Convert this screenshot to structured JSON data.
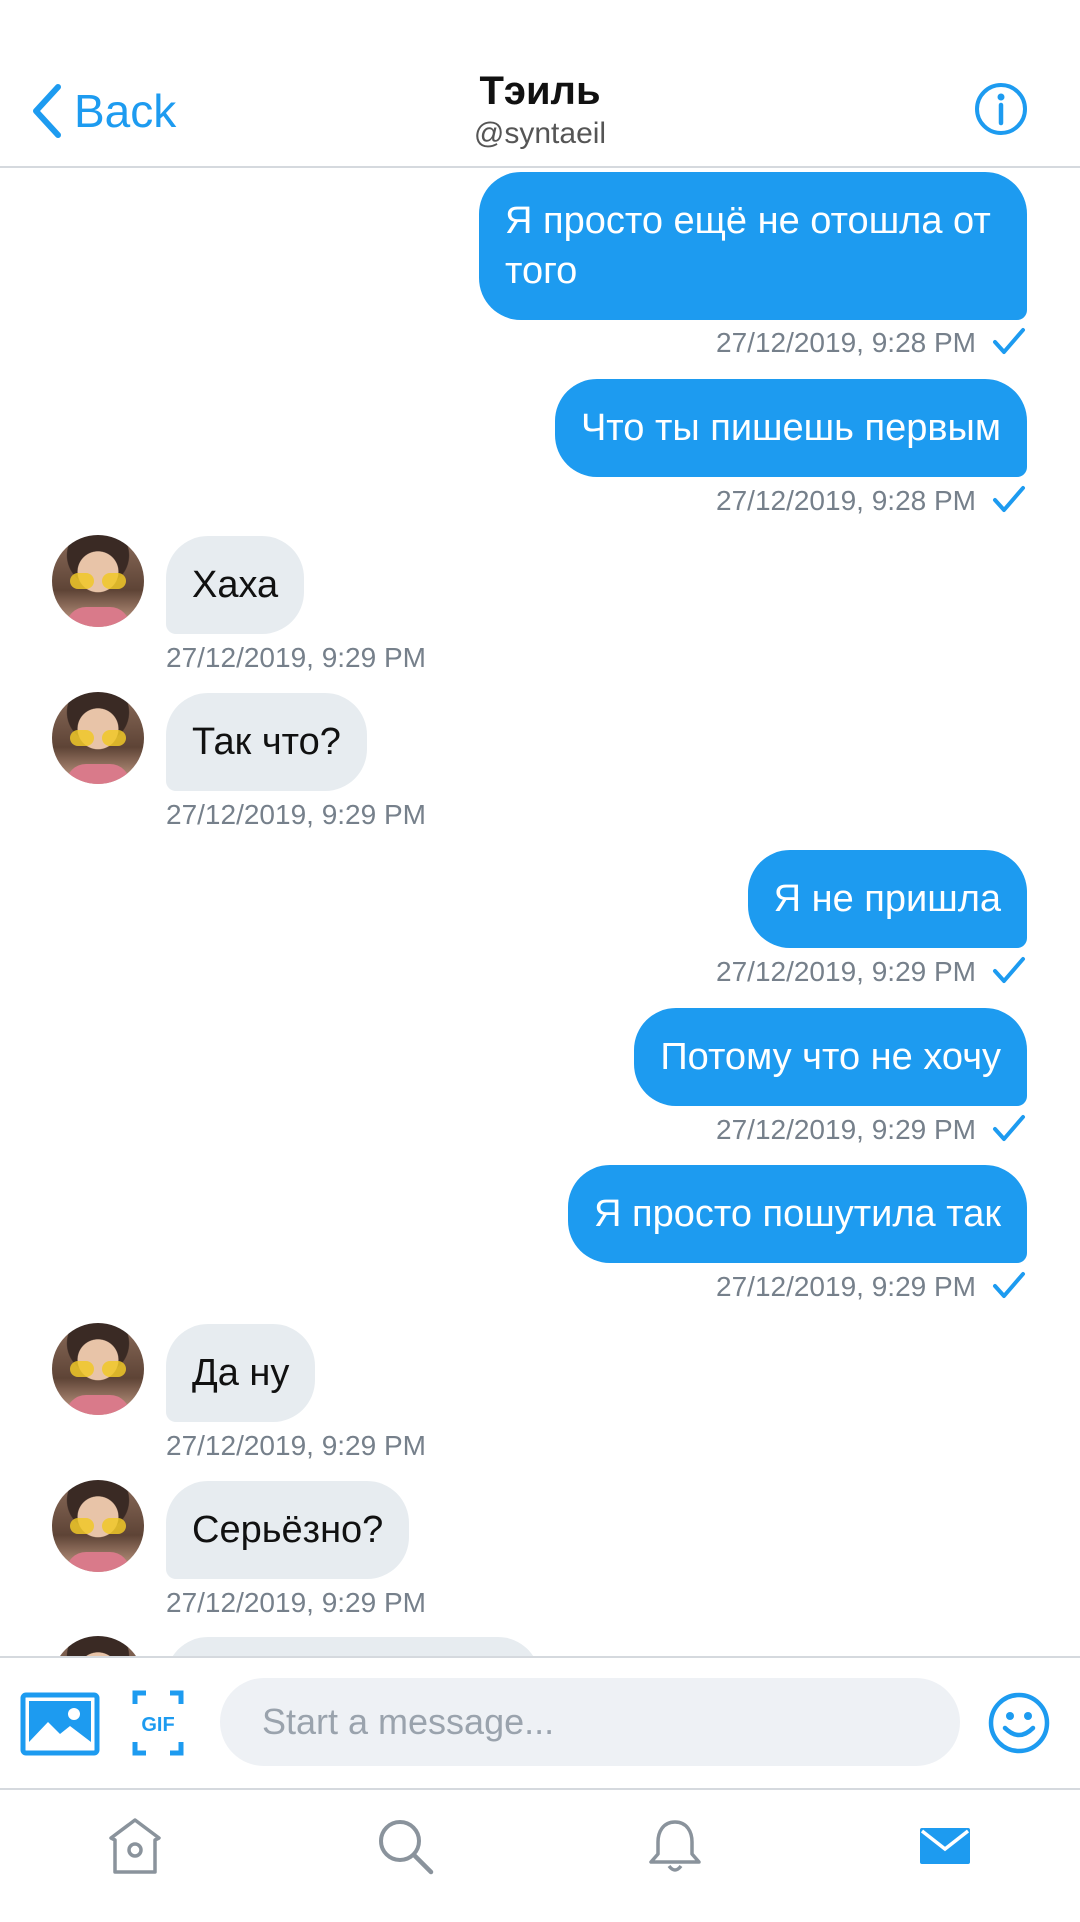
{
  "header": {
    "back_label": "Back",
    "title": "Тэиль",
    "handle": "@syntaeil"
  },
  "messages": [
    {
      "from": "me",
      "text": "Я просто ещё не отошла от того",
      "time": "27/12/2019, 9:28 PM"
    },
    {
      "from": "me",
      "text": "Что ты пишешь первым",
      "time": "27/12/2019, 9:28 PM"
    },
    {
      "from": "them",
      "text": "Хаха",
      "time": "27/12/2019, 9:29 PM"
    },
    {
      "from": "them",
      "text": "Так что?",
      "time": "27/12/2019, 9:29 PM"
    },
    {
      "from": "me",
      "text": "Я не пришла",
      "time": "27/12/2019, 9:29 PM"
    },
    {
      "from": "me",
      "text": "Потому что не хочу",
      "time": "27/12/2019, 9:29 PM"
    },
    {
      "from": "me",
      "text": "Я просто пошутила так",
      "time": "27/12/2019, 9:29 PM"
    },
    {
      "from": "them",
      "text": "Да ну",
      "time": "27/12/2019, 9:29 PM"
    },
    {
      "from": "them",
      "text": "Серьёзно?",
      "time": "27/12/2019, 9:29 PM"
    }
  ],
  "composer": {
    "placeholder": "Start a message...",
    "gif_label": "GIF"
  },
  "colors": {
    "accent": "#1d9bf0",
    "incoming_bubble": "#e7ecf0",
    "timestamp": "#76808b"
  },
  "icons": {
    "back": "chevron-left-icon",
    "info": "info-icon",
    "read_receipt": "checkmark-icon",
    "image": "image-icon",
    "gif": "gif-icon",
    "emoji": "smiley-icon",
    "tabs": [
      "home-icon",
      "search-icon",
      "bell-icon",
      "mail-icon"
    ]
  }
}
